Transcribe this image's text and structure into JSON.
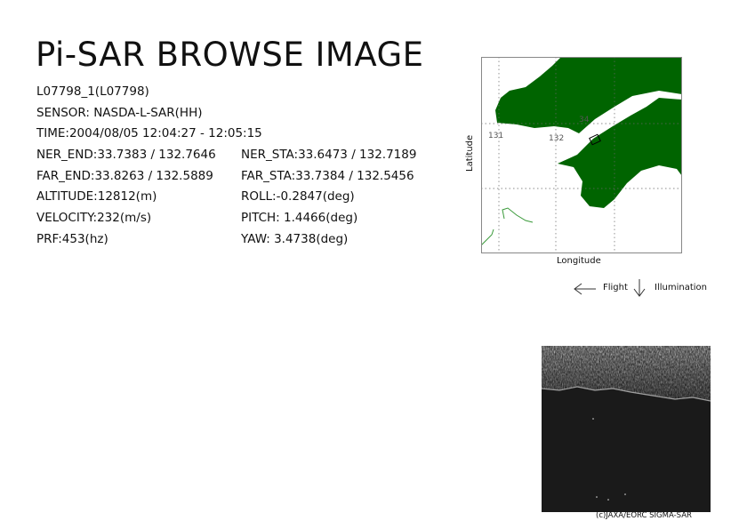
{
  "header": {
    "title": "Pi-SAR BROWSE IMAGE"
  },
  "info": {
    "scene_id": "L07798_1(L07798)",
    "sensor": "SENSOR: NASDA-L-SAR(HH)",
    "time": "TIME:2004/08/05  12:04:27 - 12:05:15",
    "ner_end": "NER_END:33.7383 / 132.7646",
    "ner_sta": "NER_STA:33.6473 / 132.7189",
    "far_end": "FAR_END:33.8263 / 132.5889",
    "far_sta": "FAR_STA:33.7384 / 132.5456",
    "altitude": "ALTITUDE:12812(m)",
    "roll": "ROLL:-0.2847(deg)",
    "velocity": "VELOCITY:232(m/s)",
    "pitch": "PITCH:  1.4466(deg)",
    "prf": "PRF:453(hz)",
    "yaw": "YAW:  3.4738(deg)"
  },
  "map": {
    "ylabel": "Latitude",
    "xlabel": "Longitude",
    "lat_tick": "34",
    "lon_tick_1": "131",
    "lon_tick_2": "132",
    "land_color": "#006400",
    "river_color": "#3a9a3a"
  },
  "legend": {
    "flight_label": "Flight",
    "illumination_label": "Illumination",
    "flight_icon": "arrow-left-icon",
    "illumination_icon": "arrow-down-icon"
  },
  "footer": {
    "copyright": "(c)JAXA/EORC SIGMA-SAR"
  }
}
